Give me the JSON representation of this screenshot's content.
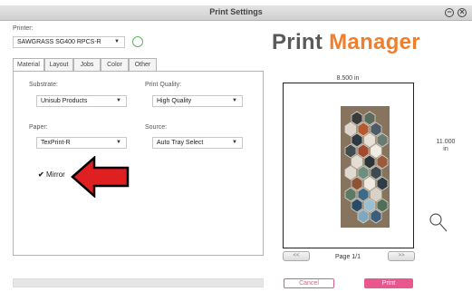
{
  "window": {
    "title": "Print Settings"
  },
  "printer": {
    "label": "Printer:",
    "value": "SAWGRASS SG400 RPCS-R"
  },
  "tabs": [
    {
      "label": "Material"
    },
    {
      "label": "Layout"
    },
    {
      "label": "Jobs"
    },
    {
      "label": "Color"
    },
    {
      "label": "Other"
    }
  ],
  "material": {
    "substrate_label": "Substrate:",
    "substrate_value": "Unisub Products",
    "print_quality_label": "Print Quality:",
    "print_quality_value": "High Quality",
    "paper_label": "Paper:",
    "paper_value": "TexPrint-R",
    "source_label": "Source:",
    "source_value": "Auto Tray Select",
    "mirror_label": "Mirror",
    "mirror_checked": true
  },
  "logo": {
    "word1": "Print",
    "word2": "Manager",
    "color1": "#5a5a5a",
    "color2": "#f07e2a"
  },
  "preview": {
    "width_label": "8.500 in",
    "height_label_1": "11.000",
    "height_label_2": "in",
    "prev_label": "<<",
    "next_label": ">>",
    "page_indicator": "Page 1/1"
  },
  "actions": {
    "cancel_label": "Cancel",
    "print_label": "Print"
  },
  "colors": {
    "accent": "#e8578e",
    "status": "#5cb85c",
    "arrow": "#e02020"
  }
}
